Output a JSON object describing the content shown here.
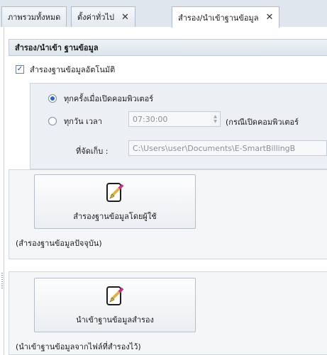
{
  "tabs": [
    {
      "label": "ภาพรวมทั้งหมด",
      "closable": false
    },
    {
      "label": "ตั้งค่าทั่วไป",
      "closable": true
    },
    {
      "label": "สำรอง/นำเข้าฐานข้อมูล",
      "closable": true,
      "active": true
    }
  ],
  "close_glyph": "✕",
  "section": {
    "header": "สำรอง/นำเข้า ฐานข้อมูล",
    "auto_backup": {
      "label": "สำรองฐานข้อมูลอัตโนมัติ",
      "checked": true
    },
    "schedule": {
      "option_startup": {
        "label": "ทุกครั้งเมื่อเปิดคอมพิวเตอร์",
        "selected": true
      },
      "option_daily": {
        "label": "ทุกวัน เวลา",
        "selected": false
      },
      "time_value": "07:30:00",
      "daily_note": "(กรณีเปิดคอมพิวเตอร์",
      "location_label": "ที่จัดเก็บ :",
      "location_value": "C:\\Users\\user\\Documents\\E-SmartBillingB"
    }
  },
  "backup": {
    "button_label": "สำรองฐานข้อมูลโดยผู้ใช้",
    "icon": "edit-document-icon",
    "caption": "(สำรองฐานข้อมูลปัจจุบัน)"
  },
  "import": {
    "button_label": "นำเข้าฐานข้อมูลสำรอง",
    "icon": "edit-document-icon",
    "caption": "(นำเข้าฐานข้อมูลจากไฟล์ที่สำรองไว้)"
  },
  "colors": {
    "accent": "#2c62c9",
    "pencil": "#c8308a"
  }
}
